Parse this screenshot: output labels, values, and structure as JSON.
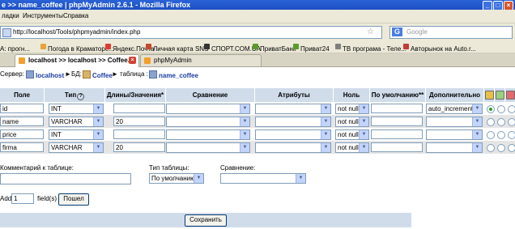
{
  "window": {
    "title": "e >> name_coffee | phpMyAdmin 2.6.1 - Mozilla Firefox"
  },
  "menu": [
    "ладки",
    "Инструменты",
    "Справка"
  ],
  "nav": {
    "url": "http://localhost/Tools/phpmyadmin/index.php",
    "search_placeholder": "Google"
  },
  "bookmarks": [
    "A: прогн...",
    "Погода в Краматорс...",
    "Яндекс.Почта",
    "Личная карта SNS",
    "СПОРТ.COM.UA",
    "ПриватБанк",
    "Приват24",
    "ТВ програма - Теле...",
    "Авторынок на Auto.r..."
  ],
  "tabs": [
    {
      "label": "localhost >> localhost >> Coffee...",
      "active": true
    },
    {
      "label": "phpMyAdmin",
      "active": false
    }
  ],
  "breadcrumb": {
    "server_label": "Сервер:",
    "server": "localhost",
    "db_label": "БД:",
    "db": "Coffee",
    "table_label": "таблица :",
    "table": "name_coffee"
  },
  "columns": [
    "Поле",
    "Тип",
    "Длины/Значения*",
    "Сравнение",
    "Атрибуты",
    "Ноль",
    "По умолчанию**",
    "Дополнительно"
  ],
  "rows": [
    {
      "name": "id",
      "type": "INT",
      "length": "",
      "collation": "",
      "attributes": "",
      "null": "not null",
      "default": "",
      "extra": "auto_increment",
      "primary": true
    },
    {
      "name": "name",
      "type": "VARCHAR",
      "length": "20",
      "collation": "",
      "attributes": "",
      "null": "not null",
      "default": "",
      "extra": "",
      "primary": false
    },
    {
      "name": "price",
      "type": "INT",
      "length": "",
      "collation": "",
      "attributes": "",
      "null": "not null",
      "default": "",
      "extra": "",
      "primary": false
    },
    {
      "name": "firma",
      "type": "VARCHAR",
      "length": "20",
      "collation": "",
      "attributes": "",
      "null": "not null",
      "default": "",
      "extra": "",
      "primary": false
    }
  ],
  "table_options": {
    "comment_label": "Комментарий к таблице:",
    "comment_value": "",
    "type_label": "Тип таблицы:",
    "type_value": "По умолчанию",
    "collation_label": "Сравнение:",
    "collation_value": ""
  },
  "add_fields": {
    "prefix": "Add",
    "count": "1",
    "suffix": "field(s)",
    "button": "Пошел"
  },
  "save_button": "Сохранить"
}
